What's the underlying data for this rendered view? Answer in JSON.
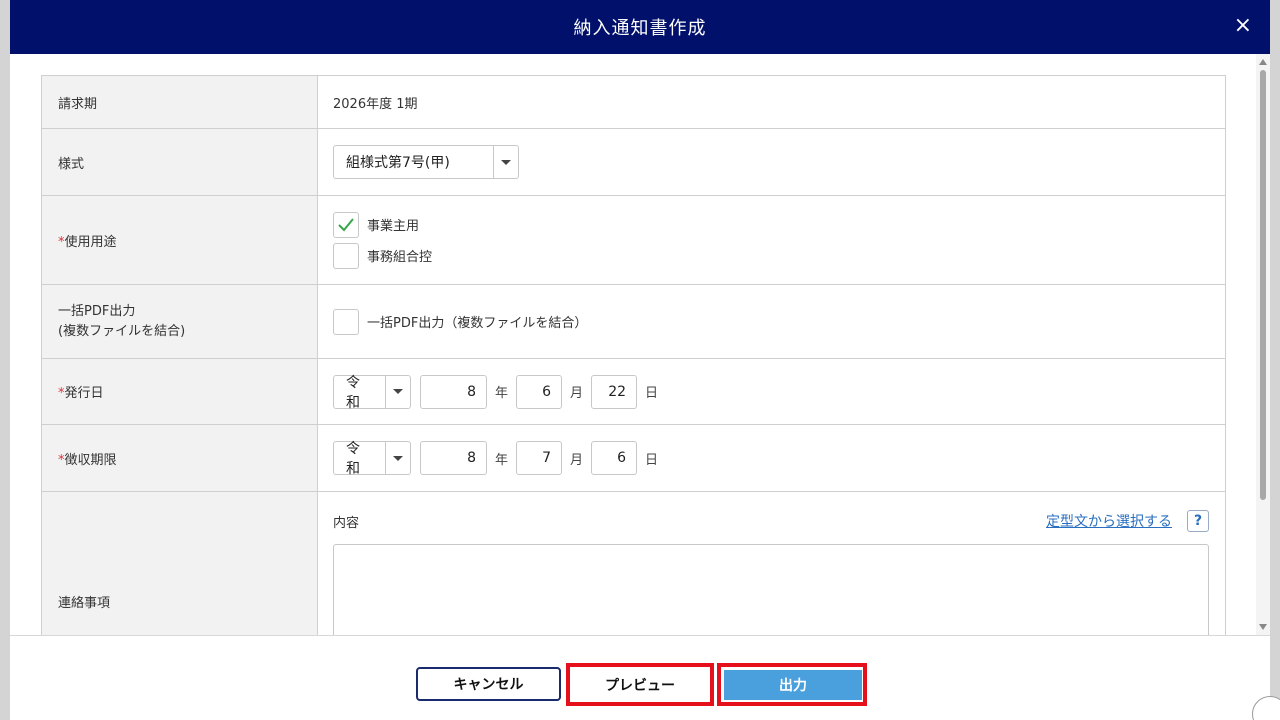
{
  "dialog": {
    "title": "納入通知書作成",
    "close": "×"
  },
  "rows": {
    "billing_period": {
      "label": "請求期",
      "value": "2026年度 1期"
    },
    "format": {
      "label": "様式",
      "selected": "組様式第7号(甲)"
    },
    "usage": {
      "required_mark": "*",
      "label": "使用用途",
      "options": [
        {
          "label": "事業主用",
          "checked": true
        },
        {
          "label": "事務組合控",
          "checked": false
        }
      ]
    },
    "bulk_pdf": {
      "label_line1": "一括PDF出力",
      "label_line2": "(複数ファイルを結合)",
      "checkbox_label": "一括PDF出力（複数ファイルを結合）",
      "checked": false
    },
    "issue_date": {
      "required_mark": "*",
      "label": "発行日",
      "era": "令和",
      "year": "8",
      "year_unit": "年",
      "month": "6",
      "month_unit": "月",
      "day": "22",
      "day_unit": "日"
    },
    "due_date": {
      "required_mark": "*",
      "label": "徴収期限",
      "era": "令和",
      "year": "8",
      "year_unit": "年",
      "month": "7",
      "month_unit": "月",
      "day": "6",
      "day_unit": "日"
    },
    "notes": {
      "label": "連絡事項",
      "content_label": "内容",
      "template_link": "定型文から選択する",
      "help": "?",
      "text": ""
    }
  },
  "footer": {
    "cancel": "キャンセル",
    "preview": "プレビュー",
    "output": "出力"
  },
  "colors": {
    "header_bg": "#00106b",
    "output_btn": "#4a9fdd",
    "highlight": "#e6101c",
    "link": "#2a6fbf",
    "required": "#e0303a"
  }
}
